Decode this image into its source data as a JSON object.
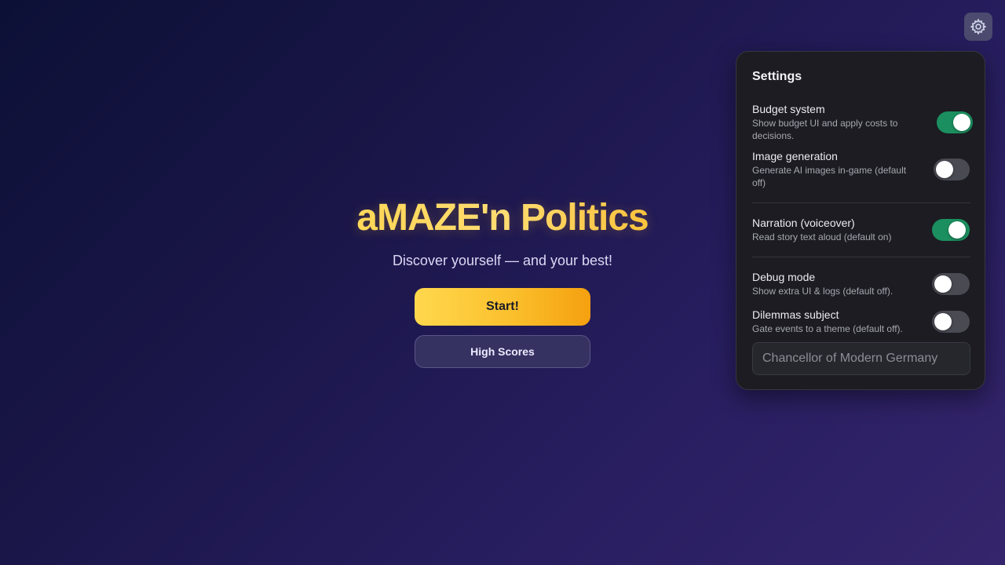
{
  "header": {
    "settings_icon": "gear-icon"
  },
  "hero": {
    "title": "aMAZE'n Politics",
    "subtitle": "Discover yourself — and your best!",
    "start_label": "Start!",
    "high_scores_label": "High Scores"
  },
  "settings": {
    "title": "Settings",
    "budget": {
      "label": "Budget system",
      "desc": "Show budget UI and apply costs to decisions.",
      "on": true
    },
    "image_generation": {
      "label": "Image generation",
      "desc": "Generate AI images in-game (default off)",
      "on": false
    },
    "narration": {
      "label": "Narration (voiceover)",
      "desc": "Read story text aloud (default on)",
      "on": true
    },
    "debug": {
      "label": "Debug mode",
      "desc": "Show extra UI & logs (default off).",
      "on": false
    },
    "dilemmas_subject": {
      "label": "Dilemmas subject",
      "desc": "Gate events to a theme (default off).",
      "on": false
    },
    "subject_placeholder": "Chancellor of Modern Germany"
  },
  "colors": {
    "accent_yellow": "#ffd84d",
    "accent_orange": "#f5a00f",
    "toggle_on": "#1b8f5f",
    "toggle_off": "#4a4a53",
    "panel_bg": "#1c1c22"
  }
}
